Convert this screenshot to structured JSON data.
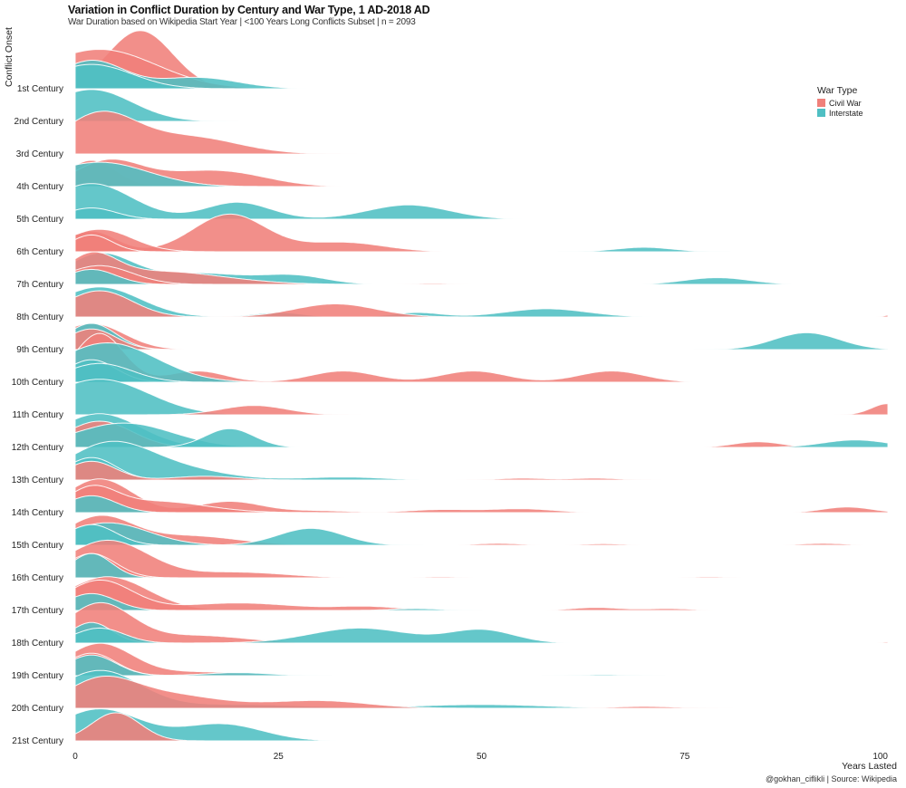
{
  "chart_data": {
    "type": "ridgeline",
    "title": "Variation in Conflict Duration by Century and War Type, 1 AD-2018 AD",
    "subtitle": "War Duration based on Wikipedia Start Year | <100 Years Long Conflicts Subset | n = 2093",
    "xlabel": "Years Lasted",
    "ylabel": "Conflict Onset",
    "caption": "@gokhan_ciflikli | Source: Wikipedia",
    "xlim": [
      0,
      100
    ],
    "xticks": [
      0,
      25,
      50,
      75,
      100
    ],
    "grid": false,
    "legend": {
      "title": "War Type",
      "position": "top-right",
      "entries": [
        {
          "name": "Civil War",
          "color": "#F0807A"
        },
        {
          "name": "Interstate",
          "color": "#4FBFC3"
        }
      ]
    },
    "categories": [
      "1st Century",
      "2nd Century",
      "3rd Century",
      "4th Century",
      "5th Century",
      "6th Century",
      "7th Century",
      "8th Century",
      "9th Century",
      "10th Century",
      "11th Century",
      "12th Century",
      "13th Century",
      "14th Century",
      "15th Century",
      "16th Century",
      "17th Century",
      "18th Century",
      "19th Century",
      "20th Century",
      "21st Century"
    ],
    "series_note": "Each ridge approximated as Gaussian components [center_years, sd_years, relative_height]",
    "ridges": [
      {
        "century": "1st Century",
        "civil": [
          [
            [
              8,
              4,
              1.55
            ]
          ],
          [
            [
              3,
              7,
              1.05
            ]
          ]
        ],
        "interstate": [
          [
            [
              2,
              4,
              0.75
            ],
            [
              15,
              5,
              0.3
            ]
          ],
          [
            [
              2,
              5,
              0.65
            ]
          ]
        ]
      },
      {
        "century": "2nd Century",
        "civil": [],
        "interstate": [
          [
            [
              2,
              5,
              0.85
            ]
          ]
        ],
        "extra_civil_under": [
          [
            [
              3,
              5,
              0.05
            ]
          ]
        ]
      },
      {
        "century": "3rd Century",
        "civil": [
          [
            [
              3,
              4.5,
              1.05
            ],
            [
              14,
              6,
              0.45
            ]
          ]
        ],
        "interstate": []
      },
      {
        "century": "4th Century",
        "civil": [
          [
            [
              2,
              3,
              0.7
            ]
          ],
          [
            [
              4,
              4,
              0.65
            ],
            [
              14,
              6,
              0.3
            ],
            [
              20,
              5,
              0.2
            ]
          ]
        ],
        "interstate": [
          [
            [
              3,
              6,
              0.65
            ]
          ]
        ]
      },
      {
        "century": "5th Century",
        "civil": [],
        "interstate": [
          [
            [
              2,
              5,
              0.95
            ],
            [
              20,
              4,
              0.45
            ],
            [
              41,
              5,
              0.38
            ]
          ],
          [
            [
              2,
              3,
              0.3
            ]
          ]
        ]
      },
      {
        "century": "6th Century",
        "civil": [
          [
            [
              2,
              3,
              0.55
            ],
            [
              19,
              4.5,
              1.0
            ],
            [
              33,
              5,
              0.25
            ]
          ],
          [
            [
              2,
              2.5,
              0.45
            ]
          ],
          [
            [
              3,
              4,
              0.6
            ]
          ]
        ],
        "interstate": [
          [
            [
              70,
              3.5,
              0.12
            ]
          ]
        ]
      },
      {
        "century": "7th Century",
        "civil": [
          [
            [
              2,
              3,
              0.65
            ],
            [
              10,
              8,
              0.35
            ]
          ],
          [
            [
              3,
              4,
              0.5
            ],
            [
              44,
              3,
              0.03
            ]
          ]
        ],
        "interstate": [
          [
            [
              3,
              4,
              0.8
            ],
            [
              15,
              6,
              0.3
            ],
            [
              27,
              4,
              0.22
            ],
            [
              79,
              4,
              0.18
            ]
          ],
          [
            [
              2,
              3,
              0.4
            ]
          ]
        ]
      },
      {
        "century": "8th Century",
        "civil": [
          [
            [
              3,
              4,
              0.7
            ],
            [
              32,
              5,
              0.35
            ],
            [
              100,
              0.5,
              0.05
            ]
          ]
        ],
        "interstate": [
          [
            [
              3,
              5,
              0.8
            ],
            [
              25,
              3,
              0.12
            ],
            [
              42,
              3,
              0.12
            ],
            [
              58,
              5,
              0.22
            ]
          ]
        ]
      },
      {
        "century": "9th Century",
        "civil": [
          [
            [
              2,
              3,
              0.55
            ]
          ],
          [
            [
              2,
              4,
              0.7
            ]
          ]
        ],
        "interstate": [
          [
            [
              2,
              3,
              0.7
            ]
          ],
          [
            [
              90,
              4,
              0.45
            ]
          ]
        ]
      },
      {
        "century": "10th Century",
        "civil": [
          [
            [
              3,
              3,
              1.3
            ],
            [
              15,
              3.5,
              0.3
            ],
            [
              33,
              4,
              0.3
            ],
            [
              49,
              4,
              0.3
            ],
            [
              66,
              4,
              0.3
            ]
          ]
        ],
        "interstate": [
          [
            [
              4,
              6,
              1.05
            ]
          ],
          [
            [
              2,
              3,
              0.6
            ]
          ],
          [
            [
              3,
              4,
              0.5
            ]
          ]
        ]
      },
      {
        "century": "11th Century",
        "civil": [
          [
            [
              22,
              4,
              0.25
            ],
            [
              100,
              2,
              0.3
            ]
          ]
        ],
        "interstate": [
          [
            [
              3,
              6,
              0.95
            ]
          ]
        ]
      },
      {
        "century": "12th Century",
        "civil": [
          [
            [
              3,
              4,
              0.7
            ],
            [
              84,
              3,
              0.15
            ]
          ]
        ],
        "interstate": [
          [
            [
              3,
              5,
              0.9
            ]
          ],
          [
            [
              19,
              3,
              0.5
            ]
          ],
          [
            [
              96,
              4,
              0.2
            ]
          ],
          [
            [
              6,
              6,
              0.65
            ]
          ]
        ]
      },
      {
        "century": "13th Century",
        "civil": [
          [
            [
              2,
              3,
              0.5
            ],
            [
              16,
              4,
              0.1
            ],
            [
              55,
              3,
              0.05
            ],
            [
              64,
              3,
              0.05
            ]
          ]
        ],
        "interstate": [
          [
            [
              4,
              5,
              0.9
            ],
            [
              12,
              6,
              0.3
            ],
            [
              33,
              5,
              0.08
            ]
          ],
          [
            [
              2,
              3,
              0.6
            ]
          ]
        ]
      },
      {
        "century": "14th Century",
        "civil": [
          [
            [
              3,
              4,
              0.9
            ],
            [
              19,
              4,
              0.3
            ],
            [
              30,
              4,
              0.05
            ],
            [
              45,
              4,
              0.08
            ],
            [
              55,
              4,
              0.1
            ],
            [
              95,
              3,
              0.15
            ]
          ],
          [
            [
              2,
              3,
              0.6
            ],
            [
              10,
              6,
              0.3
            ]
          ]
        ],
        "interstate": [
          [
            [
              2,
              3,
              0.45
            ]
          ]
        ]
      },
      {
        "century": "15th Century",
        "civil": [
          [
            [
              3,
              4,
              0.75
            ],
            [
              14,
              6,
              0.25
            ],
            [
              52,
              3,
              0.05
            ],
            [
              65,
              3,
              0.04
            ],
            [
              92,
              3,
              0.05
            ]
          ]
        ],
        "interstate": [
          [
            [
              2,
              3,
              0.55
            ],
            [
              29,
              4,
              0.45
            ]
          ],
          [
            [
              4,
              5,
              0.6
            ]
          ]
        ]
      },
      {
        "century": "16th Century",
        "civil": [
          [
            [
              4,
              5,
              1.0
            ],
            [
              20,
              6,
              0.15
            ],
            [
              45,
              3,
              0.03
            ],
            [
              78,
              3,
              0.03
            ]
          ],
          [
            [
              2,
              3,
              0.65
            ]
          ]
        ],
        "interstate": [
          [
            [
              2,
              2.5,
              0.65
            ]
          ]
        ]
      },
      {
        "century": "17th Century",
        "civil": [
          [
            [
              3,
              4,
              0.8
            ],
            [
              20,
              7,
              0.2
            ],
            [
              36,
              4,
              0.1
            ],
            [
              64,
              3,
              0.08
            ],
            [
              73,
              3,
              0.05
            ]
          ],
          [
            [
              4,
              5,
              0.9
            ]
          ]
        ],
        "interstate": [
          [
            [
              2,
              3,
              0.45
            ],
            [
              42,
              3,
              0.05
            ]
          ]
        ]
      },
      {
        "century": "18th Century",
        "civil": [
          [
            [
              3,
              4,
              1.05
            ],
            [
              15,
              6,
              0.2
            ],
            [
              100,
              1,
              0.03
            ]
          ]
        ],
        "interstate": [
          [
            [
              2,
              2.5,
              0.55
            ],
            [
              35,
              6,
              0.4
            ],
            [
              50,
              4,
              0.35
            ]
          ],
          [
            [
              3,
              3,
              0.4
            ]
          ]
        ]
      },
      {
        "century": "19th Century",
        "civil": [
          [
            [
              3,
              4,
              0.85
            ],
            [
              15,
              6,
              0.1
            ]
          ],
          [
            [
              2,
              3,
              0.6
            ]
          ]
        ],
        "interstate": [
          [
            [
              2,
              3,
              0.55
            ],
            [
              20,
              4,
              0.08
            ],
            [
              65,
              3,
              0.03
            ]
          ]
        ]
      },
      {
        "century": "20th Century",
        "civil": [
          [
            [
              3,
              4,
              0.6
            ],
            [
              10,
              7,
              0.4
            ],
            [
              30,
              6,
              0.2
            ],
            [
              70,
              4,
              0.05
            ]
          ]
        ],
        "interstate": [
          [
            [
              3,
              5,
              1.0
            ],
            [
              20,
              8,
              0.1
            ],
            [
              50,
              8,
              0.1
            ]
          ]
        ]
      },
      {
        "century": "21st Century",
        "civil": [
          [
            [
              5,
              3,
              0.75
            ]
          ]
        ],
        "interstate": [
          [
            [
              3,
              5,
              0.85
            ],
            [
              18,
              5,
              0.45
            ]
          ]
        ]
      }
    ]
  }
}
